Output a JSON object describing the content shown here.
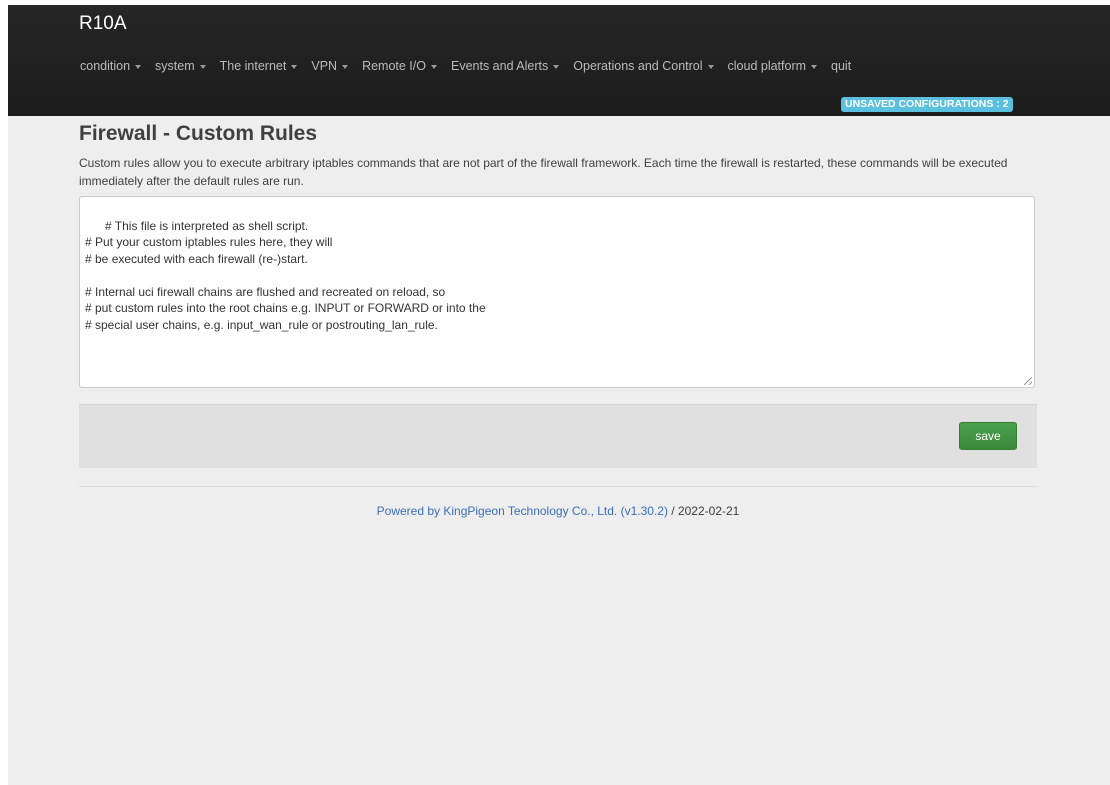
{
  "brand": "R10A",
  "menu": [
    {
      "label": "condition",
      "dropdown": true
    },
    {
      "label": "system",
      "dropdown": true
    },
    {
      "label": "The internet",
      "dropdown": true
    },
    {
      "label": "VPN",
      "dropdown": true
    },
    {
      "label": "Remote I/O",
      "dropdown": true
    },
    {
      "label": "Events and Alerts",
      "dropdown": true
    },
    {
      "label": "Operations and Control",
      "dropdown": true
    },
    {
      "label": "cloud platform",
      "dropdown": true
    },
    {
      "label": "quit",
      "dropdown": false
    }
  ],
  "badge": "UNSAVED CONFIGURATIONS : 2",
  "page": {
    "title": "Firewall - Custom Rules",
    "description": "Custom rules allow you to execute arbitrary iptables commands that are not part of the firewall framework. Each time the firewall is restarted, these commands will be executed immediately after the default rules are run.",
    "editor_value": "# This file is interpreted as shell script.\n# Put your custom iptables rules here, they will\n# be executed with each firewall (re-)start.\n\n# Internal uci firewall chains are flushed and recreated on reload, so\n# put custom rules into the root chains e.g. INPUT or FORWARD or into the\n# special user chains, e.g. input_wan_rule or postrouting_lan_rule."
  },
  "actions": {
    "save_label": "save"
  },
  "footer": {
    "link_text": "Powered by KingPigeon Technology Co., Ltd. (v1.30.2)",
    "suffix": " / 2022-02-21"
  },
  "colors": {
    "navbar": "#222222",
    "badge": "#5bc0de",
    "save_button": "#3f8f3f",
    "footer_link": "#3a6fb6"
  }
}
